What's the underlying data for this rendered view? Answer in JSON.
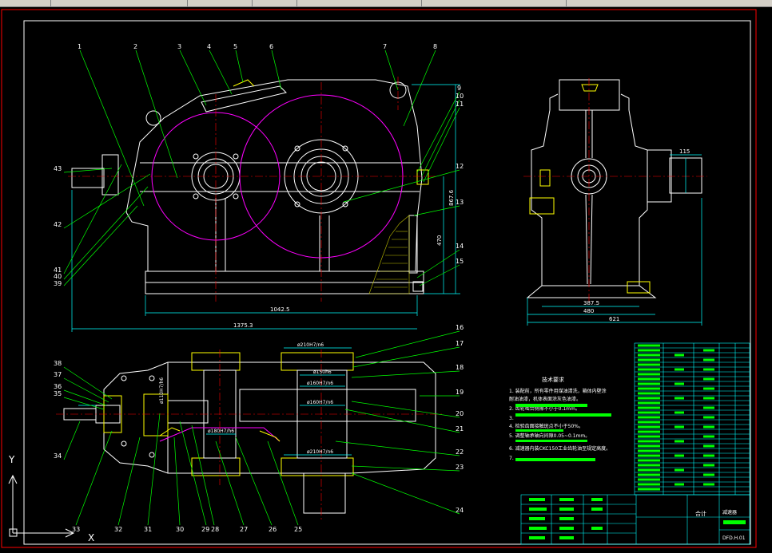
{
  "window": {
    "toolbar_cells": [
      "",
      "",
      "",
      "",
      "",
      "",
      ""
    ]
  },
  "ucs": {
    "x_label": "X",
    "y_label": "Y"
  },
  "balloons": {
    "top": [
      "1",
      "2",
      "3",
      "4",
      "5",
      "6",
      "7",
      "8"
    ],
    "right_top": [
      "9",
      "10",
      "11",
      "12",
      "13",
      "14",
      "15"
    ],
    "left_top": [
      "43",
      "42",
      "41",
      "40",
      "39"
    ],
    "right_bottom": [
      "16",
      "17",
      "18",
      "19",
      "20",
      "21",
      "22",
      "23",
      "24"
    ],
    "left_bottom": [
      "38",
      "37",
      "36",
      "35",
      "34"
    ],
    "bottom": [
      "33",
      "32",
      "31",
      "30",
      "29",
      "28",
      "27",
      "26",
      "25"
    ]
  },
  "dimensions": {
    "front_width_inner": "1042.5",
    "front_width_outer": "1375.3",
    "front_height_1": "867.6",
    "front_height_2": "470",
    "side_width_1": "387.5",
    "side_width_2": "480",
    "side_width_3": "621",
    "side_shaft": "115",
    "plan_fit_1": "ø210H7/n6",
    "plan_fit_2": "ø150h6",
    "plan_fit_3": "ø160H7/n6",
    "plan_fit_4": "ø160H7/n6",
    "plan_fit_5": "ø210H7/n6",
    "plan_fit_6": "ø180H7/h6",
    "plan_fit_7": "ø110H7/h6"
  },
  "notes": {
    "title": "技术要求",
    "items": [
      "1. 装配前，所有零件用煤油清洗，箱体内壁涂",
      "    耐油油漆，机体表面涂灰色油漆。",
      "2. 齿轮啮合侧隙不小于0.1mm。",
      "3. ",
      "4. 检验齿面接触斑点不小于50%。",
      "5. 调整轴承轴向间隙0.05~0.1mm。",
      "6. 减速器内装CKC150工业齿轮油至规定高度。",
      "7. "
    ]
  },
  "title_block": {
    "drawing_no": "DFD.H.01",
    "label_a": "减速器",
    "label_b": "合计"
  },
  "colors": {
    "background": "#000000",
    "outline": "#ffffff",
    "leader": "#00ff00",
    "dimension": "#00ffff",
    "center": "#ff0000",
    "pitch": "#ff00ff",
    "section": "#ffff00",
    "hatch": "#c0c000",
    "border": "#ff0000",
    "text": "#ffffff"
  }
}
